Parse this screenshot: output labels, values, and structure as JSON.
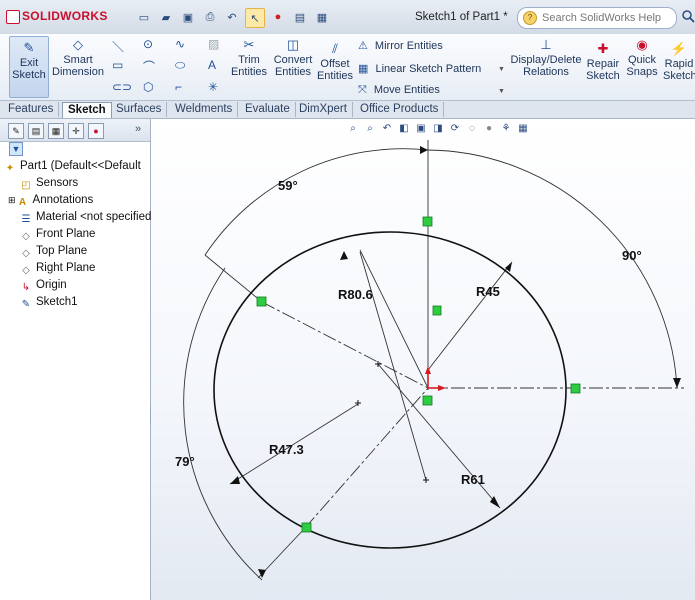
{
  "app": {
    "name": "SOLIDWORKS",
    "document_title": "Sketch1 of Part1 *"
  },
  "search": {
    "placeholder": "Search SolidWorks Help"
  },
  "ribbon": {
    "exit_sketch": "Exit Sketch",
    "smart_dimension": "Smart Dimension",
    "trim_entities": "Trim Entities",
    "convert_entities": "Convert Entities",
    "offset_entities": "Offset Entities",
    "mirror_entities": "Mirror Entities",
    "linear_sketch_pattern": "Linear Sketch Pattern",
    "move_entities": "Move Entities",
    "display_delete_relations": "Display/Delete Relations",
    "repair_sketch": "Repair Sketch",
    "quick_snaps": "Quick Snaps",
    "rapid_sketch": "Rapid Sketch"
  },
  "tabs": [
    "Features",
    "Sketch",
    "Surfaces",
    "Weldments",
    "Evaluate",
    "DimXpert",
    "Office Products"
  ],
  "tree": {
    "root": "Part1  (Default<<Default",
    "items": [
      "Sensors",
      "Annotations",
      "Material <not specified>",
      "Front Plane",
      "Top Plane",
      "Right Plane",
      "Origin",
      "Sketch1"
    ]
  },
  "dimensions": {
    "angle_top": "59°",
    "angle_right": "90°",
    "angle_left": "79°",
    "radius_80": "R80.6",
    "radius_45": "R45",
    "radius_47": "R47.3",
    "radius_61": "R61"
  },
  "colors": {
    "accent": "#1f4f96",
    "relation_marker": "#2ecc40",
    "origin": "#d31f1f"
  }
}
